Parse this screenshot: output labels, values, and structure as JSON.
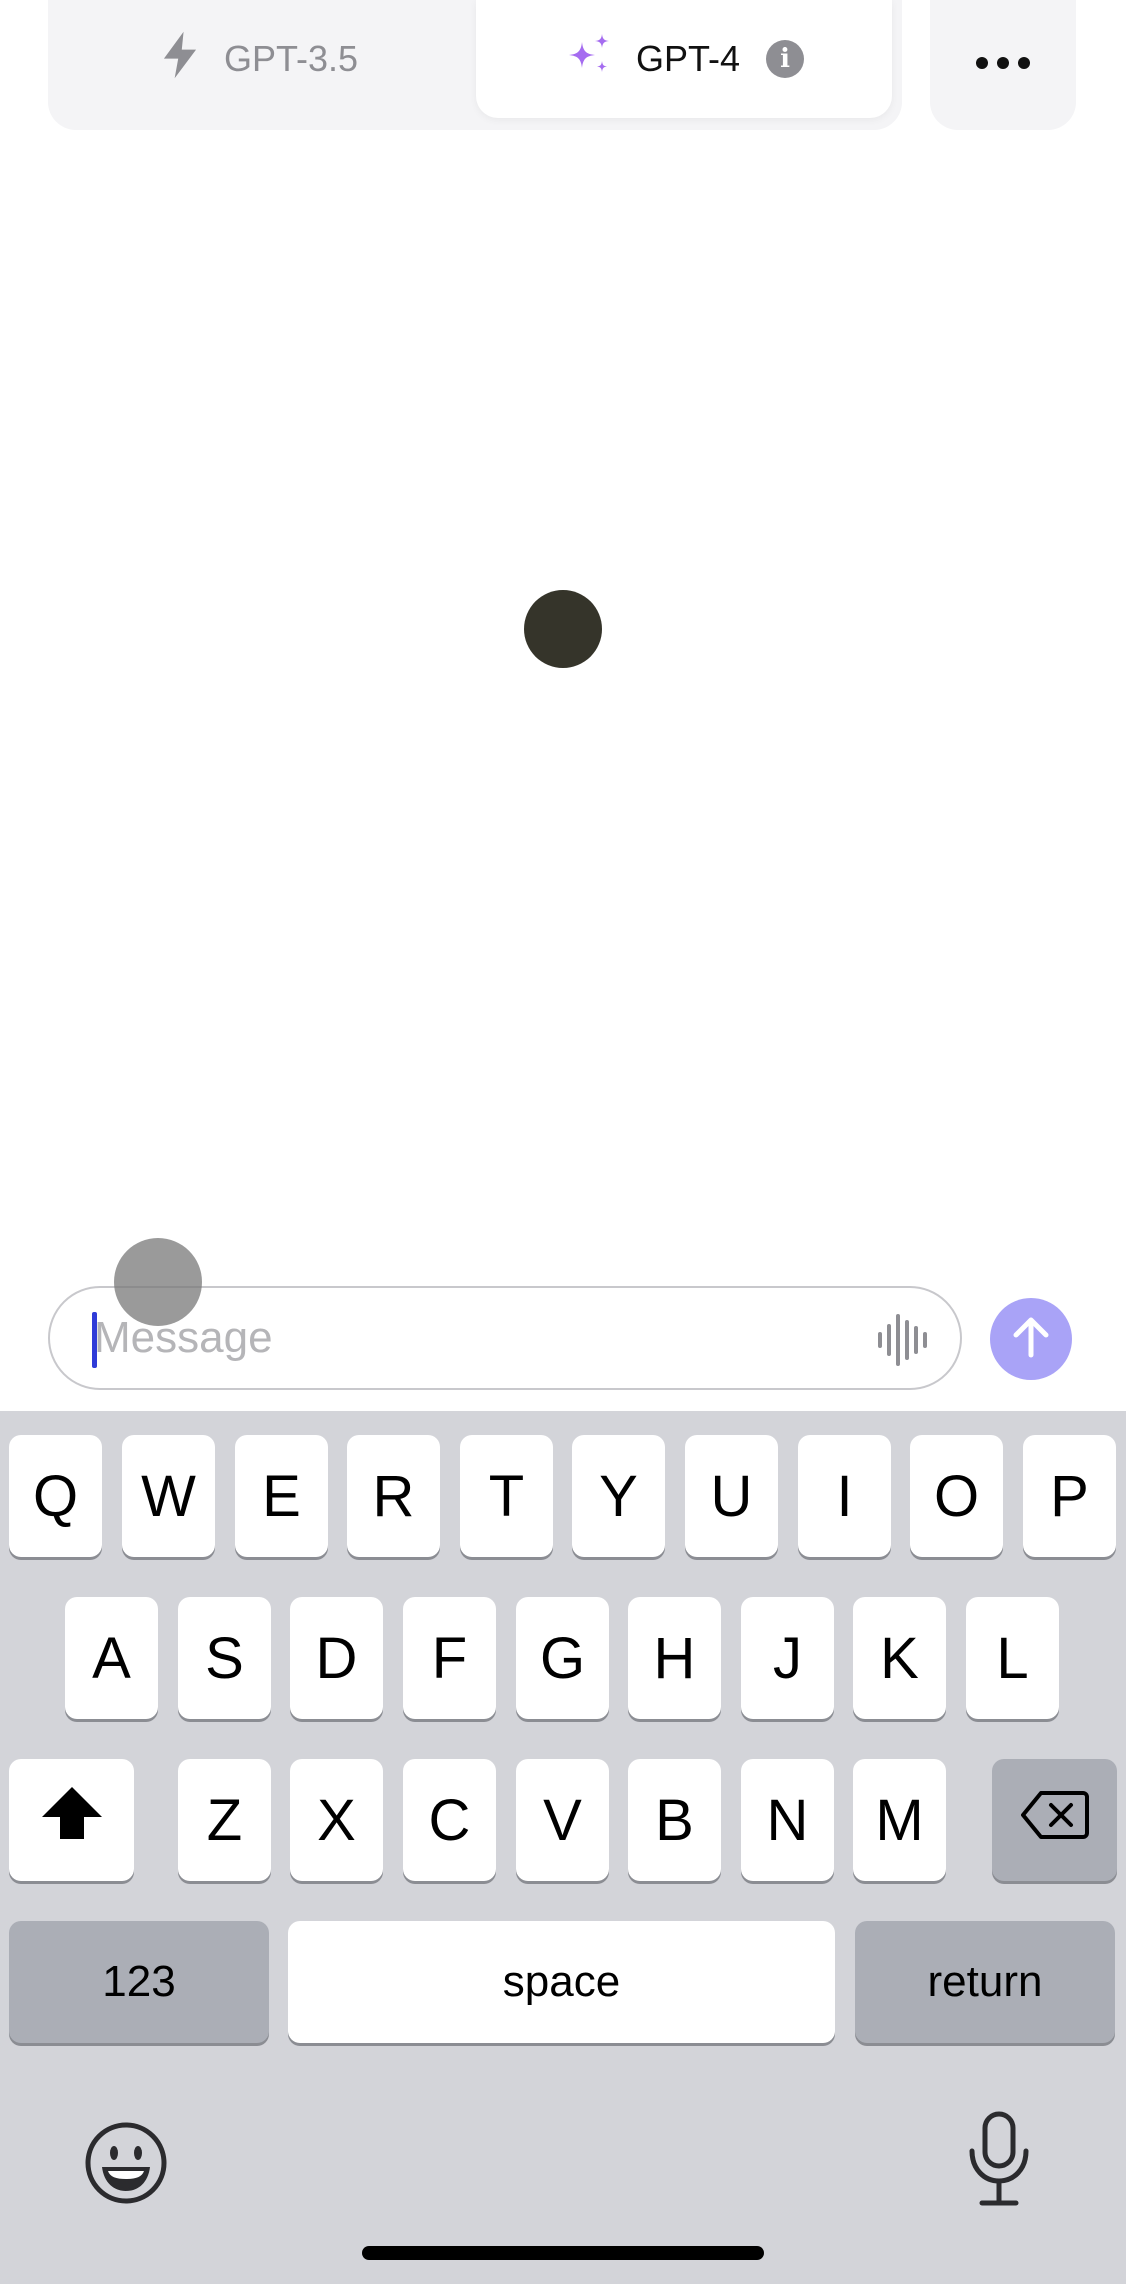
{
  "header": {
    "model_options": [
      {
        "label": "GPT-3.5",
        "icon": "bolt-icon",
        "selected": false
      },
      {
        "label": "GPT-4",
        "icon": "sparkles-icon",
        "selected": true
      }
    ],
    "info_glyph": "i",
    "more_icon": "ellipsis-icon"
  },
  "composer": {
    "placeholder": "Message",
    "value": "",
    "voice_icon": "waveform-icon",
    "send_icon": "arrow-up-icon"
  },
  "keyboard": {
    "row1": [
      "Q",
      "W",
      "E",
      "R",
      "T",
      "Y",
      "U",
      "I",
      "O",
      "P"
    ],
    "row2": [
      "A",
      "S",
      "D",
      "F",
      "G",
      "H",
      "J",
      "K",
      "L"
    ],
    "row3": [
      "Z",
      "X",
      "C",
      "V",
      "B",
      "N",
      "M"
    ],
    "numbers_label": "123",
    "space_label": "space",
    "return_label": "return",
    "shift_icon": "shift-icon",
    "delete_icon": "backspace-icon",
    "emoji_icon": "emoji-icon",
    "dictation_icon": "microphone-icon"
  },
  "colors": {
    "accent": "#a9a3f7",
    "sparkle": "#a56cf0",
    "caret": "#2f3bd8",
    "loading_dot": "#35342a",
    "keyboard_bg": "#d3d4d9"
  }
}
